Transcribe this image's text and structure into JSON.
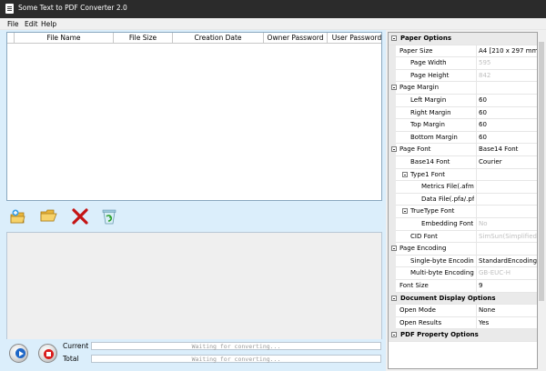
{
  "window": {
    "title": "Some Text to PDF Converter 2.0"
  },
  "menu": [
    {
      "label": "File"
    },
    {
      "label": "Edit"
    },
    {
      "label": "Help"
    }
  ],
  "file_list": {
    "columns": [
      "File Name",
      "File Size",
      "Creation Date",
      "Owner Password",
      "User Password"
    ]
  },
  "toolbar": {
    "icons": [
      "add-files-icon",
      "add-folder-icon",
      "delete-icon",
      "clear-list-icon"
    ]
  },
  "progress": {
    "current_label": "Current",
    "total_label": "Total",
    "current_status": "Waiting for converting...",
    "total_status": "Waiting for converting..."
  },
  "properties": [
    {
      "type": "cat",
      "name": "Paper Options"
    },
    {
      "type": "prop",
      "level": 0,
      "name": "Paper Size",
      "value": "A4 [210 x 297 mm]"
    },
    {
      "type": "prop",
      "level": 1,
      "name": "Page Width",
      "value": "595",
      "disabled": true
    },
    {
      "type": "prop",
      "level": 1,
      "name": "Page Height",
      "value": "842",
      "disabled": true
    },
    {
      "type": "group",
      "level": 0,
      "name": "Page Margin",
      "value": ""
    },
    {
      "type": "prop",
      "level": 1,
      "name": "Left Margin",
      "value": "60"
    },
    {
      "type": "prop",
      "level": 1,
      "name": "Right Margin",
      "value": "60"
    },
    {
      "type": "prop",
      "level": 1,
      "name": "Top Margin",
      "value": "60"
    },
    {
      "type": "prop",
      "level": 1,
      "name": "Bottom Margin",
      "value": "60"
    },
    {
      "type": "group",
      "level": 0,
      "name": "Page Font",
      "value": "Base14 Font"
    },
    {
      "type": "prop",
      "level": 1,
      "name": "Base14 Font",
      "value": "Courier"
    },
    {
      "type": "group",
      "level": 1,
      "name": "Type1 Font",
      "value": ""
    },
    {
      "type": "prop",
      "level": 2,
      "name": "Metrics File(.afm)",
      "value": ""
    },
    {
      "type": "prop",
      "level": 2,
      "name": "Data File(.pfa/.pfb)",
      "value": ""
    },
    {
      "type": "group",
      "level": 1,
      "name": "TrueType Font",
      "value": ""
    },
    {
      "type": "prop",
      "level": 2,
      "name": "Embedding Font",
      "value": "No",
      "disabled": true
    },
    {
      "type": "prop",
      "level": 1,
      "name": "CID Font",
      "value": "SimSun(Simplified Chinese)",
      "disabled": true
    },
    {
      "type": "group",
      "level": 0,
      "name": "Page Encoding",
      "value": ""
    },
    {
      "type": "prop",
      "level": 1,
      "name": "Single-byte Encoding",
      "value": "StandardEncoding"
    },
    {
      "type": "prop",
      "level": 1,
      "name": "Multi-byte Encoding",
      "value": "GB-EUC-H",
      "disabled": true
    },
    {
      "type": "prop",
      "level": 0,
      "name": "Font Size",
      "value": "9"
    },
    {
      "type": "cat",
      "name": "Document Display Options"
    },
    {
      "type": "prop",
      "level": 0,
      "name": "Open Mode",
      "value": "None"
    },
    {
      "type": "prop",
      "level": 0,
      "name": "Open Results",
      "value": "Yes"
    },
    {
      "type": "cat",
      "name": "PDF Property Options"
    }
  ],
  "colors": {
    "accent": "#dbeefb",
    "disabled_text": "#c0c0c0"
  }
}
